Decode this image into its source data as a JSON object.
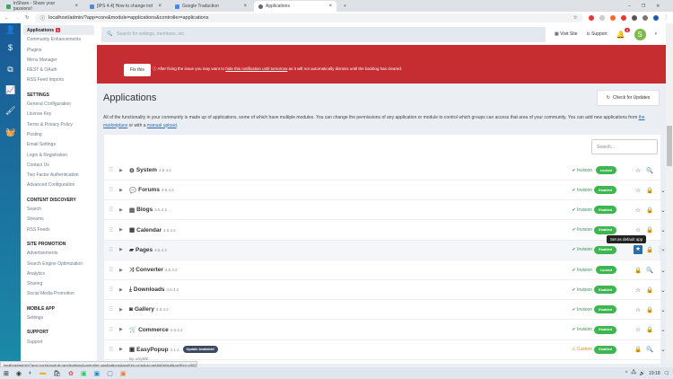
{
  "browser": {
    "tabs": [
      "InShare - Share your passions!",
      "[IPS 4.4] How to change index p...",
      "Google Traduction",
      "Applications"
    ],
    "url": "localhost/admin/?app=core&module=applications&controller=applications"
  },
  "sidebar": {
    "items": [
      {
        "label": "Applications",
        "badge": "1",
        "active": true
      },
      {
        "label": "Community Enhancements"
      },
      {
        "label": "Plugins"
      },
      {
        "label": "Menu Manager"
      },
      {
        "label": "REST & OAuth"
      },
      {
        "label": "RSS Feed Imports"
      },
      {
        "heading": "SETTINGS"
      },
      {
        "label": "General Configuration"
      },
      {
        "label": "License Key"
      },
      {
        "label": "Terms & Privacy Policy"
      },
      {
        "label": "Posting"
      },
      {
        "label": "Email Settings"
      },
      {
        "label": "Login & Registration"
      },
      {
        "label": "Contact Us"
      },
      {
        "label": "Two Factor Authentication"
      },
      {
        "label": "Advanced Configuration"
      },
      {
        "heading": "CONTENT DISCOVERY"
      },
      {
        "label": "Search"
      },
      {
        "label": "Streams"
      },
      {
        "label": "RSS Feeds"
      },
      {
        "heading": "SITE PROMOTION"
      },
      {
        "label": "Advertisements"
      },
      {
        "label": "Search Engine Optimization"
      },
      {
        "label": "Analytics"
      },
      {
        "label": "Sharing"
      },
      {
        "label": "Social Media Promotion"
      },
      {
        "heading": "MOBILE APP"
      },
      {
        "label": "Settings"
      },
      {
        "heading": "SUPPORT"
      },
      {
        "label": "Support"
      }
    ]
  },
  "header": {
    "search_placeholder": "Search for settings, members, etc.",
    "visit_site": "Visit Site",
    "support": "Support",
    "notif_count": "4",
    "avatar": "S"
  },
  "banner": {
    "fix": "Fix this",
    "note_pre": "After fixing the issue you may want to ",
    "note_link": "hide this notification until tomorrow",
    "note_post": " as it will not automatically dismiss until the backlog has cleared."
  },
  "page": {
    "title": "Applications",
    "check_updates": "Check for Updates",
    "desc_pre": "All of the functionality in your community is made up of applications, some of which have multiple modules. You can change the permissions of any application or module to control which groups can access that area of your community. You can add new applications from ",
    "link1": "the marketplace",
    "desc_mid": " or with a ",
    "link2": "manual upload",
    "desc_end": ".",
    "search_placeholder": "Search..."
  },
  "apps": [
    {
      "name": "System",
      "version": "4.5.4.2",
      "icon": "⚙",
      "author": "Invision",
      "status": "Locked",
      "icons": [
        "star",
        "search"
      ]
    },
    {
      "name": "Forums",
      "version": "4.5.4.2",
      "icon": "💬",
      "author": "Invision",
      "status": "Enabled",
      "icons": [
        "star",
        "lock",
        "chevron"
      ]
    },
    {
      "name": "Blogs",
      "version": "4.5.4.2",
      "icon": "▤",
      "author": "Invision",
      "status": "Enabled",
      "icons": [
        "star",
        "lock",
        "chevron"
      ]
    },
    {
      "name": "Calendar",
      "version": "4.5.4.2",
      "icon": "▦",
      "author": "Invision",
      "status": "Enabled",
      "icons": [
        "star",
        "lock",
        "chevron"
      ]
    },
    {
      "name": "Pages",
      "version": "4.5.4.2",
      "icon": "▰",
      "author": "Invision",
      "status": "Enabled",
      "icons": [
        "star",
        "lock",
        "chevron"
      ],
      "hover": true
    },
    {
      "name": "Converter",
      "version": "4.5.4.2",
      "icon": "⤨",
      "author": "Invision",
      "status": "Locked",
      "icons": [
        "lock",
        "search",
        "chevron"
      ]
    },
    {
      "name": "Downloads",
      "version": "4.5.4.2",
      "icon": "⤓",
      "author": "Invision",
      "status": "Enabled",
      "icons": [
        "star",
        "lock",
        "chevron"
      ]
    },
    {
      "name": "Gallery",
      "version": "4.5.4.2",
      "icon": "◙",
      "author": "Invision",
      "status": "Enabled",
      "icons": [
        "star",
        "lock",
        "chevron"
      ]
    },
    {
      "name": "Commerce",
      "version": "4.5.4.2",
      "icon": "🛒",
      "author": "Invision",
      "status": "Enabled",
      "icons": [
        "star",
        "lock",
        "chevron"
      ]
    },
    {
      "name": "EasyPopup",
      "version": "2.1.4",
      "icon": "▣",
      "author": "Custom",
      "status": "Enabled",
      "icons": [
        "lock",
        "search",
        "chevron"
      ],
      "update": "Update Available!",
      "by": "By onlyME"
    }
  ],
  "tooltip": "Set as default app",
  "statusbar": "localhost/admin/?app=core&module=applications&controller=applications&appKey=cms&do=setAsDefault&csrfKey=c9827da9de38cd7158d38c577056da4c",
  "clock": "19:18"
}
